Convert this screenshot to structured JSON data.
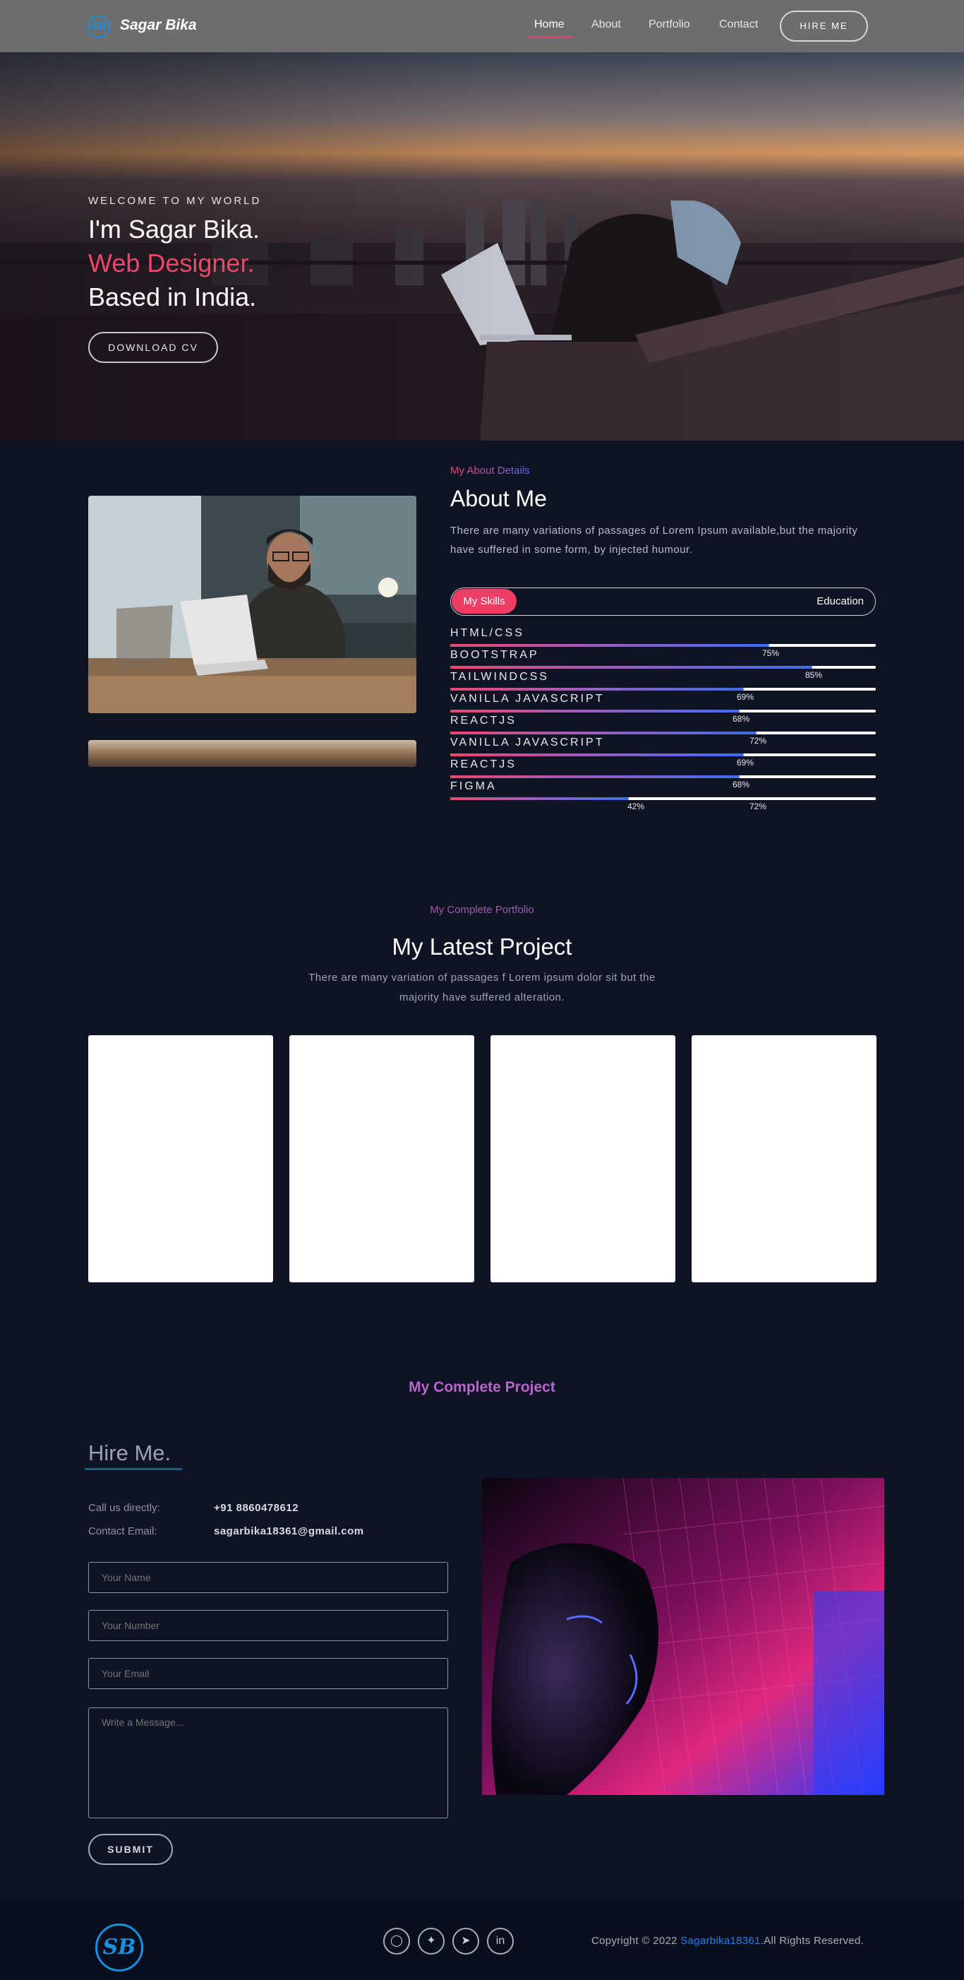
{
  "nav": {
    "logo_text": "Sagar Bika",
    "links": [
      {
        "label": "Home"
      },
      {
        "label": "About"
      },
      {
        "label": "Portfolio"
      },
      {
        "label": "Contact"
      }
    ],
    "hire_label": "HIRE ME"
  },
  "hero": {
    "welcome": "WELCOME TO MY WORLD",
    "line1": "I'm Sagar Bika.",
    "line2": "Web Designer.",
    "line3": "Based in India.",
    "cv_label": "DOWNLOAD CV"
  },
  "about": {
    "subtitle": "My About Details",
    "title": "About Me",
    "description": "There are many variations of passages of Lorem Ipsum available,but the majority have suffered in some form, by injected humour.",
    "tab_skills": "My Skills",
    "tab_education": "Education",
    "skills": [
      {
        "name": "HTML/CSS",
        "level": 0.75,
        "pct": "75%"
      },
      {
        "name": "BOOTSTRAP",
        "level": 0.85,
        "pct": "85%"
      },
      {
        "name": "TAILWINDCSS",
        "level": 0.69,
        "pct": "69%"
      },
      {
        "name": "VANILLA JAVASCRIPT",
        "level": 0.68,
        "pct": "68%"
      },
      {
        "name": "REACTJS",
        "level": 0.72,
        "pct": "72%"
      },
      {
        "name": "VANILLA JAVASCRIPT",
        "level": 0.69,
        "pct": "69%"
      },
      {
        "name": "REACTJS",
        "level": 0.68,
        "pct": "68%"
      },
      {
        "name": "FIGMA",
        "level": 0.72,
        "pct": "72%"
      }
    ],
    "final_pct": "42%",
    "final_level": 0.42
  },
  "portfolio": {
    "subtitle": "My Complete Portfolio",
    "title": "My Latest Project",
    "description": "There are many variation of passages f Lorem ipsum dolor sit but the majority have suffered alteration."
  },
  "contact": {
    "section_title": "My Complete Project",
    "hire_title": "Hire Me.",
    "call_label": "Call us directly:",
    "call_value": "+91 8860478612",
    "email_label": "Contact Email:",
    "email_value": "sagarbika18361@gmail.com",
    "name_placeholder": "Your Name",
    "number_placeholder": "Your Number",
    "email_placeholder": "Your Email",
    "message_placeholder": "Write a Message...",
    "submit_label": "SUBMIT"
  },
  "footer": {
    "logo_text": "SB",
    "copyright_prefix": "Copyright © 2022 ",
    "copyright_link": "Sagarbika18361",
    "copyright_suffix": ".All Rights Reserved.",
    "socials": [
      "instagram-icon",
      "twitter-icon",
      "telegram-icon",
      "linkedin-icon"
    ]
  },
  "colors": {
    "accent": "#f0466c",
    "background": "#0e1424",
    "footer_bg": "#0a0f1d",
    "link_blue": "#1e7ff0"
  }
}
